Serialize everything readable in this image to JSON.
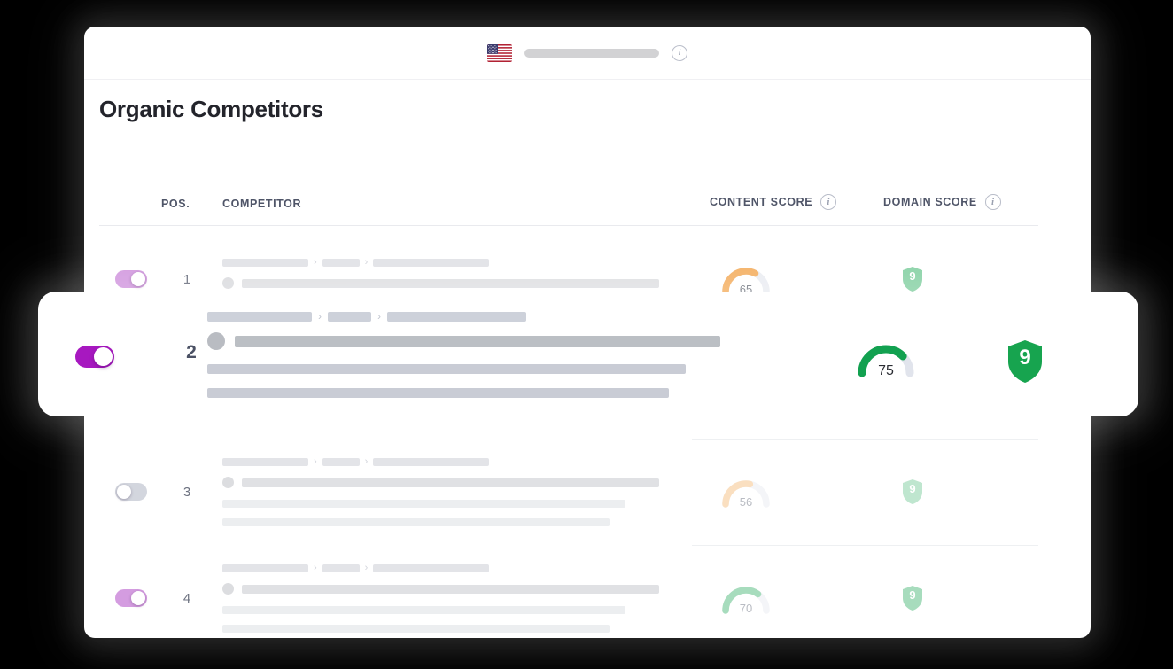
{
  "topbar": {
    "flag": "us-flag-icon",
    "url_placeholder": "",
    "info_icon": "info-icon",
    "info_label": "i"
  },
  "page": {
    "title": "Organic Competitors"
  },
  "table": {
    "headers": {
      "position": "POS.",
      "competitor": "COMPETITOR",
      "content_score": "CONTENT SCORE",
      "domain_score": "DOMAIN SCORE",
      "content_score_info": "i",
      "domain_score_info": "i"
    },
    "rows": [
      {
        "position": "1",
        "toggle_state": "on",
        "toggle_label": "Compare competitor 1",
        "content_score": "65",
        "content_score_color": "#f5b267",
        "content_score_pct": 65,
        "domain_score": "9",
        "domain_score_color": "#8bd3a8",
        "highlighted": "false"
      },
      {
        "position": "2",
        "toggle_state": "on",
        "toggle_label": "Compare competitor 2",
        "content_score": "75",
        "content_score_color": "#12a150",
        "content_score_pct": 75,
        "domain_score": "9",
        "domain_score_color": "#17a44f",
        "highlighted": "true"
      },
      {
        "position": "3",
        "toggle_state": "off",
        "toggle_label": "Compare competitor 3",
        "content_score": "56",
        "content_score_color": "#fadfc0",
        "content_score_pct": 56,
        "domain_score": "9",
        "domain_score_color": "#bfe6cf",
        "highlighted": "false"
      },
      {
        "position": "4",
        "toggle_state": "on",
        "toggle_label": "Compare competitor 4",
        "content_score": "70",
        "content_score_color": "#a7dcbd",
        "content_score_pct": 70,
        "domain_score": "9",
        "domain_score_color": "#a7dcbd",
        "highlighted": "false"
      }
    ]
  },
  "colors": {
    "toggle_on_active": "#a718c0",
    "toggle_on_muted": "#d49ce0",
    "toggle_off": "#d3d6de",
    "gauge_track": "#e6e8ee",
    "title_text": "#23242b",
    "header_text": "#4f5568",
    "background": "#000000",
    "card": "#ffffff"
  }
}
